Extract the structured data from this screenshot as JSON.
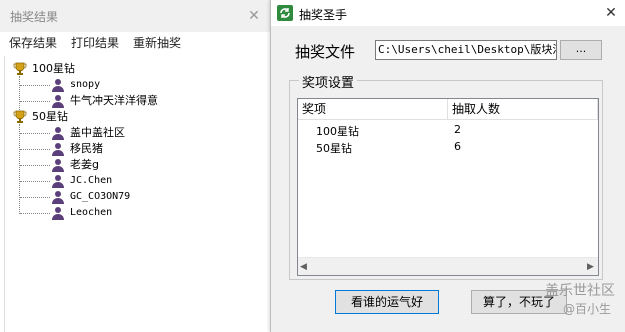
{
  "results_window": {
    "title": "抽奖结果",
    "menu": [
      "保存结果",
      "打印结果",
      "重新抽奖"
    ],
    "tree": [
      {
        "label": "100星钻",
        "children": [
          "snopy",
          "牛气冲天洋洋得意"
        ]
      },
      {
        "label": "50星钻",
        "children": [
          "盖中盖社区",
          "移民猪",
          "老姜g",
          "JC.Chen",
          "GC_CO3ON79",
          "Leochen"
        ]
      }
    ]
  },
  "dialog": {
    "title": "抽奖圣手",
    "file_label": "抽奖文件",
    "file_path": "C:\\Users\\cheil\\Desktop\\版块活",
    "browse_label": "...",
    "group_label": "奖项设置",
    "table": {
      "headers": [
        "奖项",
        "抽取人数"
      ],
      "rows": [
        [
          "100星钻",
          "2"
        ],
        [
          "50星钻",
          "6"
        ]
      ]
    },
    "lucky_button": "看谁的运气好",
    "cancel_button": "算了，不玩了"
  },
  "watermark": {
    "line1": "盖乐世社区",
    "line2": "@百小生"
  },
  "colors": {
    "trophy": "#d4a017",
    "user_icon": "#5a3f7a",
    "app_icon": "#2e8b3d",
    "focus_border": "#0078d7"
  }
}
